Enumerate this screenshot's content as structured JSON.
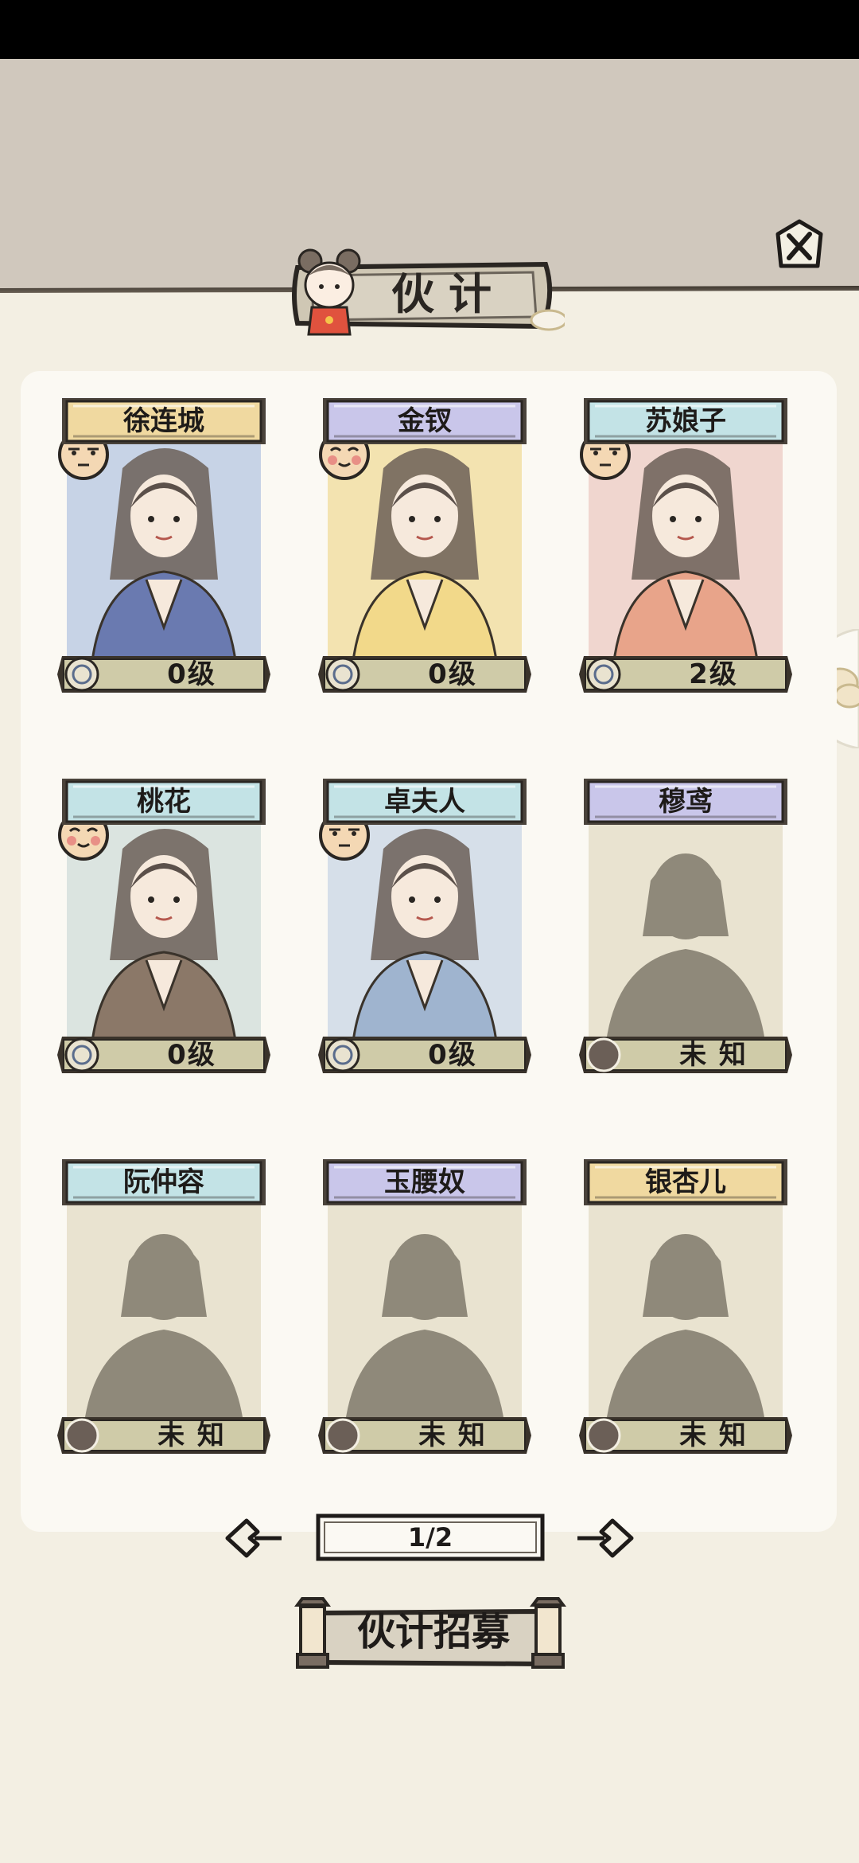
{
  "header": {
    "title": "伙计"
  },
  "companions": [
    {
      "name": "徐连城",
      "level": "0级",
      "plate": "gold",
      "unlocked": true,
      "mood": "neutral-face-icon",
      "badge": "scroll-badge-icon"
    },
    {
      "name": "金钗",
      "level": "0级",
      "plate": "purple",
      "unlocked": true,
      "mood": "happy-blush-face-icon",
      "badge": "hairpin-badge-icon"
    },
    {
      "name": "苏娘子",
      "level": "2级",
      "plate": "teal",
      "unlocked": true,
      "mood": "neutral-face-icon",
      "badge": "star-badge-icon"
    },
    {
      "name": "桃花",
      "level": "0级",
      "plate": "teal",
      "unlocked": true,
      "mood": "happy-blush-face-icon",
      "badge": "star-badge-icon"
    },
    {
      "name": "卓夫人",
      "level": "0级",
      "plate": "teal",
      "unlocked": true,
      "mood": "neutral-face-icon",
      "badge": "star-badge-icon"
    },
    {
      "name": "穆鸢",
      "level": "未 知",
      "plate": "purple",
      "unlocked": false
    },
    {
      "name": "阮仲容",
      "level": "未 知",
      "plate": "teal",
      "unlocked": false
    },
    {
      "name": "玉腰奴",
      "level": "未 知",
      "plate": "purple",
      "unlocked": false
    },
    {
      "name": "银杏儿",
      "level": "未 知",
      "plate": "gold",
      "unlocked": false
    }
  ],
  "pagination": {
    "label": "1/2"
  },
  "recruit_button": {
    "label": "伙计招募"
  },
  "colors": {
    "plate_gold": "#f0d9a0",
    "plate_purple": "#c9c6ea",
    "plate_teal": "#c3e3e6",
    "level_bar": "#cfcba8",
    "silhouette": "#8f897a"
  }
}
